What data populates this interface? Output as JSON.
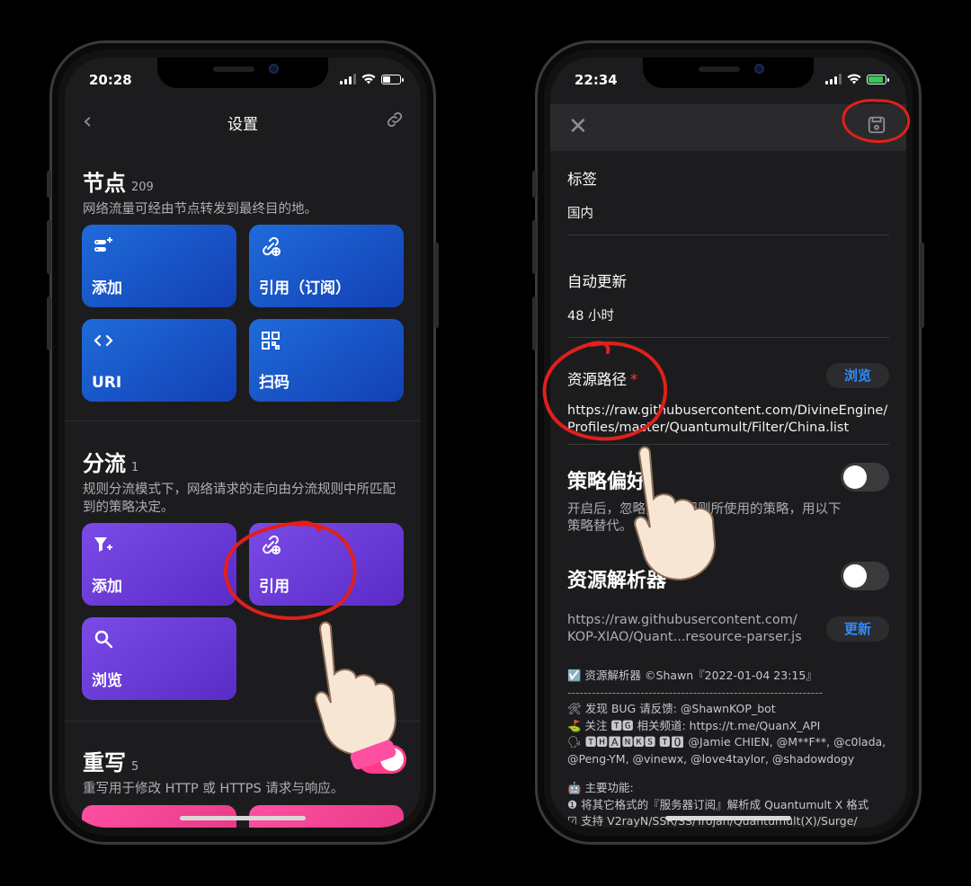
{
  "left_phone": {
    "status": {
      "time": "20:28"
    },
    "navbar": {
      "title": "设置",
      "back_icon": "chevron-left-icon",
      "right_icon": "link-icon"
    },
    "nodes": {
      "title": "节点",
      "count": "209",
      "desc": "网络流量可经由节点转发到最终目的地。",
      "tiles": [
        {
          "label": "添加",
          "icon": "server-add-icon"
        },
        {
          "label": "引用（订阅）",
          "icon": "link-add-icon"
        },
        {
          "label": "URI",
          "icon": "code-icon"
        },
        {
          "label": "扫码",
          "icon": "qr-code-icon"
        }
      ]
    },
    "filter": {
      "title": "分流",
      "count": "1",
      "desc": "规则分流模式下，网络请求的走向由分流规则中所匹配到的策略决定。",
      "tiles": [
        {
          "label": "添加",
          "icon": "filter-add-icon"
        },
        {
          "label": "引用",
          "icon": "link-add-icon"
        },
        {
          "label": "浏览",
          "icon": "search-icon"
        }
      ]
    },
    "rewrite": {
      "title": "重写",
      "count": "5",
      "desc": "重写用于修改 HTTP 或 HTTPS 请求与响应。",
      "toggle_on": true
    }
  },
  "right_phone": {
    "status": {
      "time": "22:34"
    },
    "navbar": {
      "close_icon": "close-icon",
      "save_icon": "save-icon"
    },
    "tag": {
      "label": "标签",
      "value": "国内"
    },
    "auto_update": {
      "label": "自动更新",
      "value": "48 小时"
    },
    "resource_path": {
      "label": "资源路径",
      "required": "*",
      "browse": "浏览",
      "url_line1": "https://raw.githubusercontent.com/DivineEngine/",
      "url_line2": "Profiles/master/Quantumult/Filter/China.list"
    },
    "policy_override": {
      "title": "策略偏好",
      "desc_line1": "开启后，忽略资源下规则所使用的策略，用以下",
      "desc_line2": "策略替代。",
      "toggle_on": false
    },
    "resource_parser": {
      "title": "资源解析器",
      "toggle_on": false,
      "url_line1": "https://raw.githubusercontent.com/",
      "url_line2": "KOP-XIAO/Quant...resource-parser.js",
      "update": "更新"
    },
    "info_lines": [
      "☑️ 资源解析器 ©Shawn『2022-01-04 23:15』",
      "---------------------------------------------------------------",
      "🛠 发现 BUG 请反馈: @ShawnKOP_bot",
      "⛳ 关注 🆃🅶 相关频道: https://t.me/QuanX_API",
      "🗣 🆃🅷🅰🅽🅺🆂 🆃🅾 @Jamie CHIEN, @M**F**, @c0lada,",
      "@Peng-YM, @vinewx, @love4taylor, @shadowdogy",
      "",
      "🤖 主要功能:",
      "❶ 将其它格式的『服务器订阅』解析成 Quantumult X 格式",
      "☑ 支持 V2rayN/SSR/SS/Trojan/Quantumult(X)/Surge/"
    ]
  },
  "colors": {
    "blue_tile": "#1f6bd9",
    "purple_tile": "#6a3bd9",
    "pink_tile": "#ff4fa0",
    "accent_link": "#2f8cff",
    "annotation_red": "#e0201b"
  }
}
